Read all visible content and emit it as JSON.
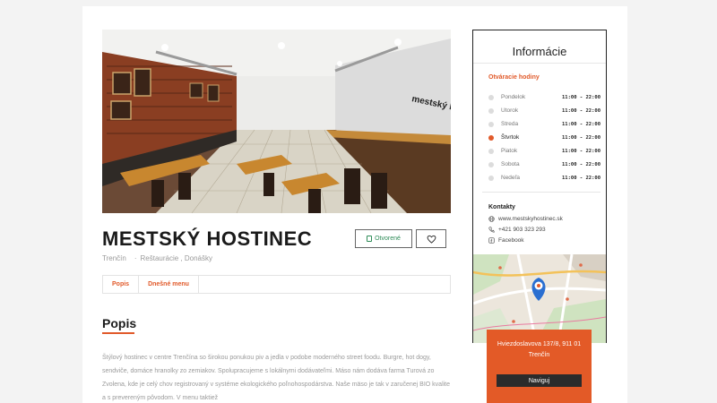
{
  "restaurant": {
    "name": "MESTSKÝ HOSTINEC",
    "city": "Trenčín",
    "categories": "Reštaurácie , Donášky",
    "sign_text": "mestský hostinec"
  },
  "buttons": {
    "open_label": "Otvorené",
    "favorite_icon": "heart-icon"
  },
  "tabs": [
    {
      "label": "Popis"
    },
    {
      "label": "Dnešné menu"
    }
  ],
  "section": {
    "title": "Popis",
    "description": "Štýlový hostinec v centre Trenčína so širokou ponukou piv a jedla v podobe moderného street foodu. Burgre, hot dogy, sendviče, domáce hranolky zo zemiakov. Spolupracujeme s lokálnymi dodávateľmi. Máso nám dodáva farma Turová zo Zvolena, kde je celý chov registrovaný v systéme ekologického poľnohospodárstva. Naše mäso je tak v zaručenej BIO kvalite a s prevereným pôvodom. V menu taktiež"
  },
  "sidebar": {
    "title": "Informácie",
    "hours_title": "Otváracie hodiny",
    "hours": [
      {
        "day": "Pondelok",
        "time": "11:00 - 22:00",
        "active": false
      },
      {
        "day": "Utorok",
        "time": "11:00 - 22:00",
        "active": false
      },
      {
        "day": "Streda",
        "time": "11:00 - 22:00",
        "active": false
      },
      {
        "day": "Štvrtok",
        "time": "11:00 - 22:00",
        "active": true
      },
      {
        "day": "Piatok",
        "time": "11:00 - 22:00",
        "active": false
      },
      {
        "day": "Sobota",
        "time": "11:00 - 22:00",
        "active": false
      },
      {
        "day": "Nedeľa",
        "time": "11:00 - 22:00",
        "active": false
      }
    ],
    "contacts_title": "Kontakty",
    "contacts": {
      "web": "www.mestskyhostinec.sk",
      "phone": "+421 903 323 293",
      "facebook": "Facebook"
    }
  },
  "address": {
    "line1": "Hviezdoslavova 137/8, 911 01",
    "line2": "Trenčín",
    "navigate_label": "Naviguj"
  },
  "colors": {
    "accent": "#e15a2a",
    "open_green": "#2e8b57",
    "dark": "#2b2b2b"
  }
}
